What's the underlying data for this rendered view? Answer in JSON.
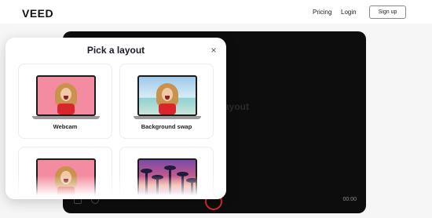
{
  "header": {
    "logo": "VEED",
    "nav": {
      "pricing": "Pricing",
      "login": "Login"
    },
    "signup_label": "Sign up"
  },
  "stage": {
    "partial_title": "ayout",
    "timer": "00:00"
  },
  "modal": {
    "title": "Pick a layout",
    "close_glyph": "×",
    "cards": [
      {
        "label": "Webcam",
        "preview_background": "pink"
      },
      {
        "label": "Background swap",
        "preview_background": "sky"
      },
      {
        "label": "",
        "preview_background": "pink"
      },
      {
        "label": "",
        "preview_background": "sunset-palms"
      }
    ]
  },
  "colors": {
    "stage_background": "#0d0d0d",
    "record_ring": "#d12b2b",
    "preview_pink": "#f38ca0",
    "scarf_red": "#d9262c"
  },
  "icons": [
    "close-icon",
    "record-icon",
    "layout-icon",
    "camera-icon"
  ]
}
